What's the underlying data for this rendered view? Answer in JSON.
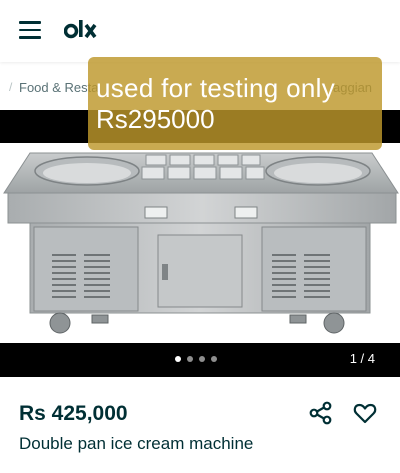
{
  "header": {
    "menu_icon": "hamburger-menu-icon",
    "logo_text": "olx"
  },
  "breadcrumb": {
    "items": [
      "Food & Restaurants",
      "Gujranwala, Faggian"
    ],
    "visible_start": "Food & Resta",
    "visible_end": "aggian"
  },
  "overlay": {
    "line1": "used for testing only",
    "line2": "Rs295000"
  },
  "gallery": {
    "counter": "1 / 4",
    "dot_count": 4,
    "active_dot": 0
  },
  "listing": {
    "price": "Rs 425,000",
    "title": "Double pan ice cream machine",
    "share_icon": "share-icon",
    "favorite_icon": "heart-icon"
  },
  "colors": {
    "brand_text": "#002f34",
    "overlay": "#bd972b",
    "gallery_bar": "#000000"
  }
}
